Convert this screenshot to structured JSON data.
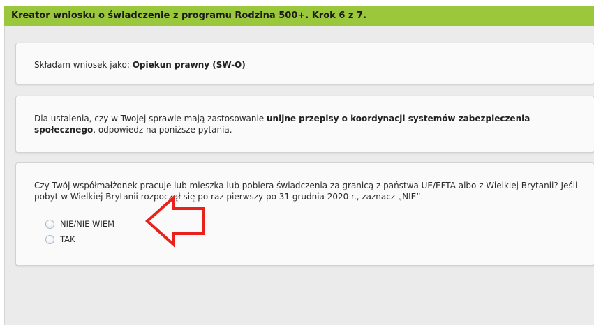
{
  "header": {
    "title": "Kreator wniosku o świadczenie z programu Rodzina 500+. Krok 6 z 7."
  },
  "applicant": {
    "prefix": "Składam wniosek jako: ",
    "role": "Opiekun prawny (SW-O)"
  },
  "coordination": {
    "text_before": "Dla ustalenia, czy w Twojej sprawie mają zastosowanie ",
    "text_bold": "unijne przepisy o koordynacji systemów zabezpieczenia społecznego",
    "text_after": ", odpowiedz na poniższe pytania."
  },
  "question": {
    "text": "Czy Twój współmałżonek pracuje lub mieszka lub pobiera świadczenia za granicą z państwa UE/EFTA albo z Wielkiej Brytanii? Jeśli pobyt w Wielkiej Brytanii rozpoczął się po raz pierwszy po 31 grudnia 2020 r., zaznacz „NIE”.",
    "options": [
      {
        "label": "NIE/NIE WIEM",
        "selected": false
      },
      {
        "label": "TAK",
        "selected": false
      }
    ]
  },
  "annotation": {
    "arrow_color": "#e8211b",
    "arrow_icon": "arrow-left-icon"
  },
  "colors": {
    "header_bg": "#9bc73c",
    "content_bg": "#ebebeb",
    "card_bg": "#fafafa"
  }
}
